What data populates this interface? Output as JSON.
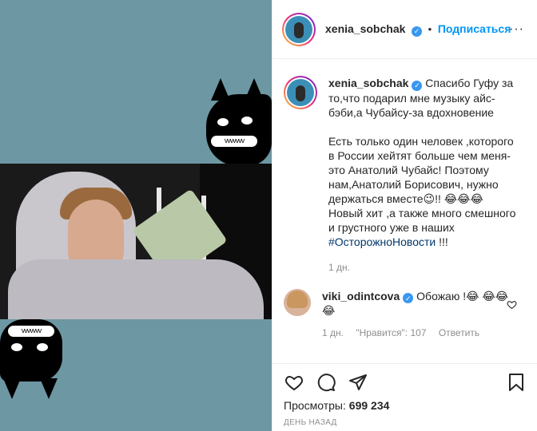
{
  "post": {
    "author": "xenia_sobchak",
    "follow_label": "Подписаться",
    "separator": "•",
    "more_label": "···",
    "verified_glyph": "✓"
  },
  "caption": {
    "author": "xenia_sobchak",
    "line1": "Спасибо Гуфу за то,что подарил мне музыку айс-бэби,а Чубайсу-за вдохновение",
    "line2": "Есть только один человек ,которого в России хейтят больше чем меня-это Анатолий Чубайс! Поэтому нам,Анатолий Борисович, нужно держаться вместе😉!! 😂😂😂 Новый хит ,а также много смешного и грустного уже в наших",
    "hashtag": "#ОсторожноНовости",
    "tail": " !!!",
    "age": "1 дн."
  },
  "comment": {
    "author": "viki_odintcova",
    "text": "Обожаю !😂 😂😂😂",
    "age": "1 дн.",
    "likes_label": "\"Нравится\": 107",
    "reply_label": "Ответить"
  },
  "stats": {
    "views_label": "Просмотры: ",
    "views_value": "699 234",
    "date": "ДЕНЬ НАЗАД"
  },
  "icons": {
    "like": "heart-icon",
    "comment": "comment-icon",
    "share": "share-icon",
    "save": "bookmark-icon",
    "comment_like": "heart-icon"
  },
  "colors": {
    "accent": "#0095f6",
    "media_bg": "#6d97a3",
    "hashtag": "#00376b",
    "muted": "#8e8e8e",
    "verified": "#3897f0"
  }
}
